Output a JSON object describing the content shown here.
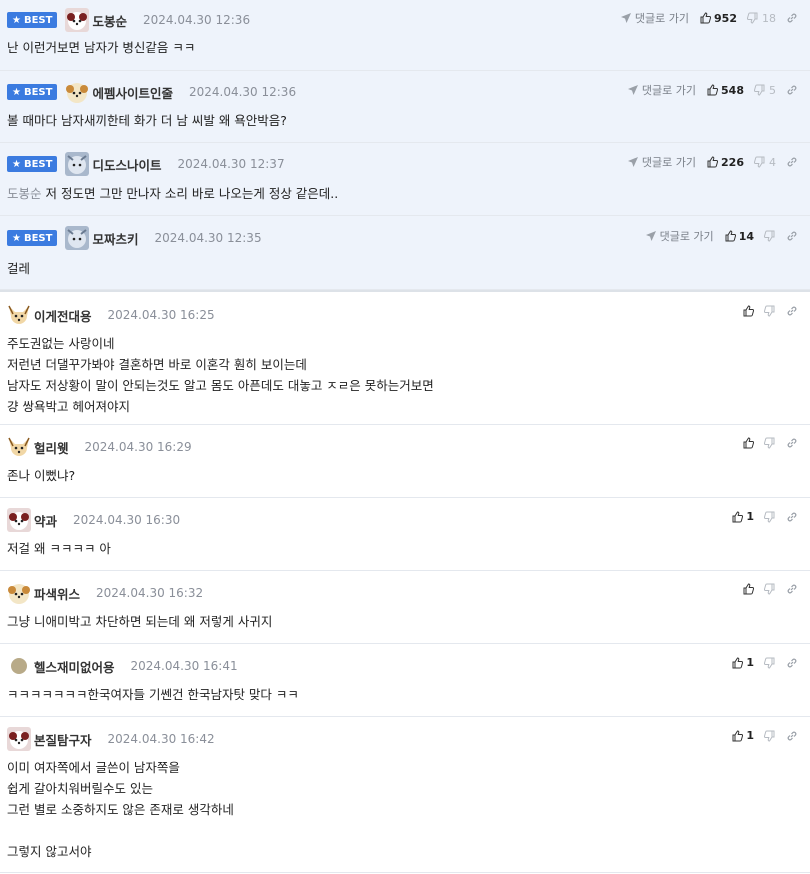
{
  "best_badge": "BEST",
  "goto_label": "댓글로 가기",
  "best": [
    {
      "nick": "도봉순",
      "date": "2024.04.30 12:36",
      "up": "952",
      "down": "18",
      "lines": [
        "난 이런거보면 남자가 병신같음 ㅋㅋ"
      ],
      "mention": ""
    },
    {
      "nick": "에펨사이트인줄",
      "date": "2024.04.30 12:36",
      "up": "548",
      "down": "5",
      "lines": [
        "볼 때마다 남자새끼한테 화가 더 남 씨발 왜 욕안박음?"
      ],
      "mention": ""
    },
    {
      "nick": "디도스나이트",
      "date": "2024.04.30 12:37",
      "up": "226",
      "down": "4",
      "lines": [
        "저 정도면 그만 만나자 소리 바로 나오는게 정상 같은데.."
      ],
      "mention": "도봉순"
    },
    {
      "nick": "모짜츠키",
      "date": "2024.04.30 12:35",
      "up": "14",
      "down": "",
      "lines": [
        "걸레"
      ],
      "mention": ""
    }
  ],
  "comments": [
    {
      "nick": "이게전대용",
      "date": "2024.04.30 16:25",
      "up": "",
      "lines": [
        "주도권없는 사랑이네",
        "저런년 더댈꾸가봐야 결혼하면 바로 이혼각 훤히 보이는데",
        "남자도 저상황이 말이 안되는것도 알고 몸도 아픈데도 대놓고 ㅈㄹ은 못하는거보면",
        "걍 쌍욕박고 헤어져야지"
      ]
    },
    {
      "nick": "헐리웻",
      "date": "2024.04.30 16:29",
      "up": "",
      "lines": [
        "존나 이뻤냐?"
      ]
    },
    {
      "nick": "약과",
      "date": "2024.04.30 16:30",
      "up": "1",
      "lines": [
        "저걸 왜 ㅋㅋㅋㅋ 아"
      ]
    },
    {
      "nick": "파색위스",
      "date": "2024.04.30 16:32",
      "up": "",
      "lines": [
        "그냥 니애미박고 차단하면 되는데 왜 저렇게 사귀지"
      ]
    },
    {
      "nick": "헬스재미없어용",
      "date": "2024.04.30 16:41",
      "up": "1",
      "lines": [
        "ㅋㅋㅋㅋㅋㅋㅋ한국여자들 기쎈건 한국남자탓 맞다 ㅋㅋ"
      ]
    },
    {
      "nick": "본질탐구자",
      "date": "2024.04.30 16:42",
      "up": "1",
      "lines": [
        "이미 여자쪽에서 글쓴이 남자쪽을",
        "쉽게 갈아치워버릴수도 있는",
        "그런 별로 소중하지도 않은 존재로 생각하네",
        "",
        "그렇지 않고서야"
      ]
    }
  ],
  "colors": {
    "badge": "#3b7be0",
    "best_bg": "#eef3fb",
    "date": "#8a8f99"
  }
}
